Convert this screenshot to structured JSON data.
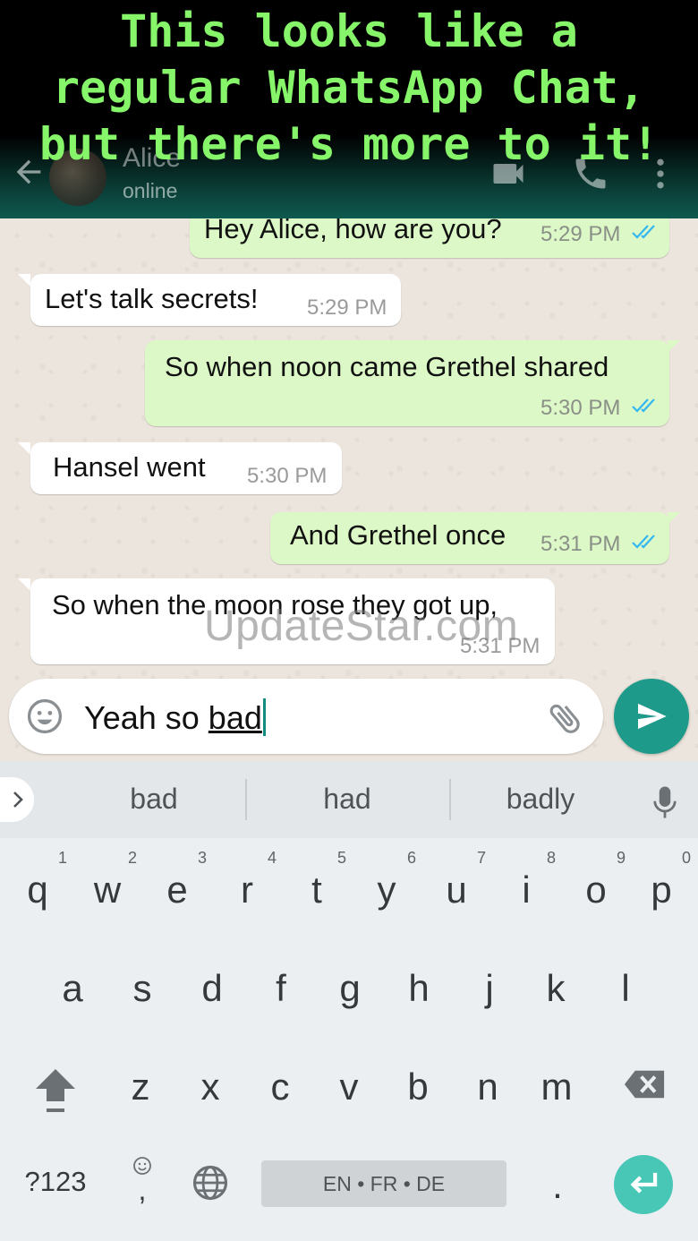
{
  "caption": "This looks like a\nregular WhatsApp Chat,\nbut there's more to it!",
  "header": {
    "contact_name": "Alice",
    "status": "online",
    "icons": [
      "back-arrow-icon",
      "avatar",
      "video-call-icon",
      "phone-icon",
      "more-vert-icon"
    ]
  },
  "messages": [
    {
      "dir": "out",
      "text": "Hey Alice, how are you?",
      "time": "5:29 PM",
      "ticks": "double-blue"
    },
    {
      "dir": "in",
      "text": "Let's talk secrets!",
      "time": "5:29 PM"
    },
    {
      "dir": "out",
      "text": "So when noon came Grethel shared",
      "time": "5:30 PM",
      "ticks": "double-blue"
    },
    {
      "dir": "in",
      "text": "Hansel went",
      "time": "5:30 PM"
    },
    {
      "dir": "out",
      "text": "And Grethel once",
      "time": "5:31 PM",
      "ticks": "double-blue"
    },
    {
      "dir": "in",
      "text": "So when the moon rose they got up,",
      "time": "5:31 PM"
    }
  ],
  "watermark": "UpdateStar.com",
  "composer": {
    "text_before": "Yeah so ",
    "text_underlined": "bad",
    "icons": [
      "emoji-icon",
      "attach-icon",
      "send-icon"
    ]
  },
  "keyboard": {
    "suggestions": [
      "bad",
      "had",
      "badly"
    ],
    "row1": [
      {
        "key": "q",
        "hint": "1"
      },
      {
        "key": "w",
        "hint": "2"
      },
      {
        "key": "e",
        "hint": "3"
      },
      {
        "key": "r",
        "hint": "4"
      },
      {
        "key": "t",
        "hint": "5"
      },
      {
        "key": "y",
        "hint": "6"
      },
      {
        "key": "u",
        "hint": "7"
      },
      {
        "key": "i",
        "hint": "8"
      },
      {
        "key": "o",
        "hint": "9"
      },
      {
        "key": "p",
        "hint": "0"
      }
    ],
    "row2": [
      "a",
      "s",
      "d",
      "f",
      "g",
      "h",
      "j",
      "k",
      "l"
    ],
    "row3": [
      "z",
      "x",
      "c",
      "v",
      "b",
      "n",
      "m"
    ],
    "symbols_label": "?123",
    "comma_label": ",",
    "space_label": "EN • FR • DE",
    "period_label": ".",
    "colors": {
      "enter": "#48c7b6",
      "send": "#1d9a8a",
      "outgoing_bubble": "#dcf8c6",
      "caption": "#86f56a"
    }
  }
}
